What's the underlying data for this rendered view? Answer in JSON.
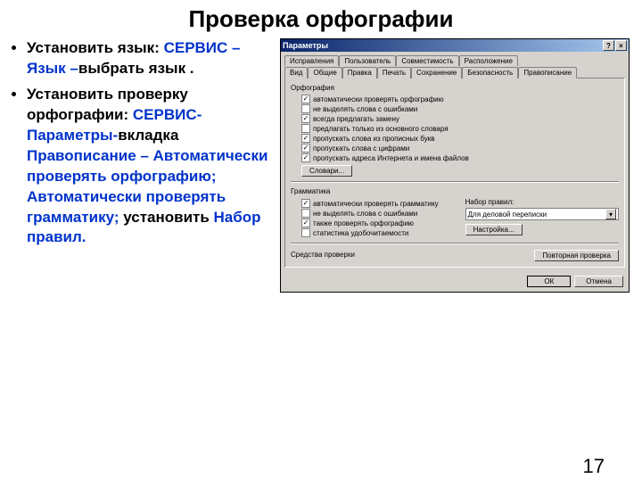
{
  "slide": {
    "title": "Проверка орфографии",
    "bullet1": {
      "lead": "Установить язык: ",
      "blue": "СЕРВИС – Язык –",
      "rest": "выбрать язык ."
    },
    "bullet2": {
      "lead": "Установить проверку орфографии: ",
      "blue1": "СЕРВИС-Параметры-",
      "mid1": "вкладка ",
      "blue2": "Правописание – Автоматически проверять орфографию; Автоматически проверять грамматику;",
      "mid2": " установить ",
      "blue3": "Набор правил."
    },
    "page_number": "17"
  },
  "dialog": {
    "title": "Параметры",
    "help": "?",
    "close": "×",
    "tabs_row1": [
      "Исправления",
      "Пользователь",
      "Совместимость",
      "Расположение"
    ],
    "tabs_row2": [
      "Вид",
      "Общие",
      "Правка",
      "Печать",
      "Сохранение",
      "Безопасность",
      "Правописание"
    ],
    "active_tab": "Правописание",
    "orf_label": "Орфография",
    "orf_checks": [
      {
        "label": "автоматически проверять орфографию",
        "checked": true
      },
      {
        "label": "не выделять слова с ошибками",
        "checked": false
      },
      {
        "label": "всегда предлагать замену",
        "checked": true
      },
      {
        "label": "предлагать только из основного словаря",
        "checked": false
      },
      {
        "label": "пропускать слова из прописных букв",
        "checked": true
      },
      {
        "label": "пропускать слова с цифрами",
        "checked": true
      },
      {
        "label": "пропускать адреса Интернета и имена файлов",
        "checked": true
      }
    ],
    "dict_btn": "Словари...",
    "gram_label": "Грамматика",
    "gram_checks": [
      {
        "label": "автоматически проверять грамматику",
        "checked": true
      },
      {
        "label": "не выделять слова с ошибками",
        "checked": false
      },
      {
        "label": "также проверять орфографию",
        "checked": true
      },
      {
        "label": "статистика удобочитаемости",
        "checked": false
      }
    ],
    "rules_label": "Набор правил:",
    "rules_value": "Для деловой переписки",
    "settings_btn": "Настройка...",
    "tools_label": "Средства проверки",
    "recheck_btn": "Повторная проверка",
    "ok": "ОК",
    "cancel": "Отмена"
  }
}
